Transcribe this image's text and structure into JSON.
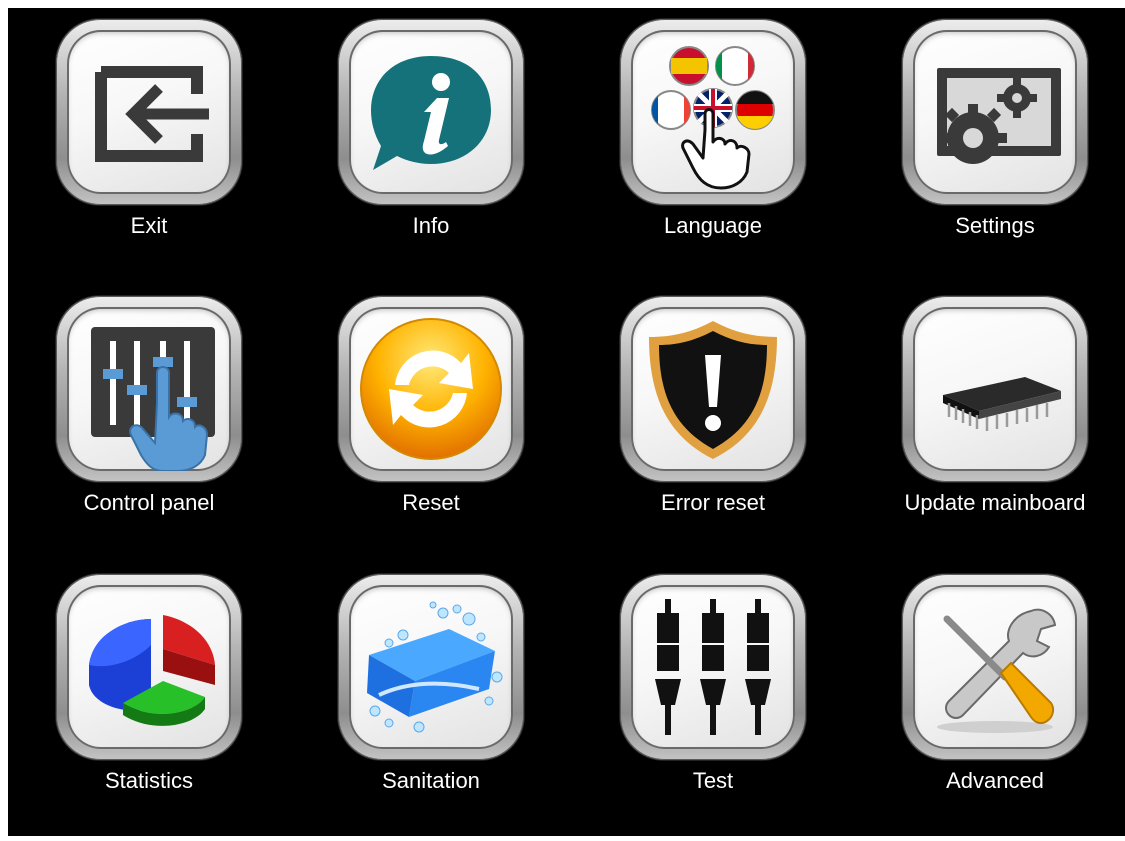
{
  "menu": {
    "items": [
      {
        "label": "Exit",
        "icon": "exit-icon"
      },
      {
        "label": "Info",
        "icon": "info-icon"
      },
      {
        "label": "Language",
        "icon": "language-icon"
      },
      {
        "label": "Settings",
        "icon": "settings-icon"
      },
      {
        "label": "Control panel",
        "icon": "control-panel-icon"
      },
      {
        "label": "Reset",
        "icon": "reset-icon"
      },
      {
        "label": "Error reset",
        "icon": "error-reset-icon"
      },
      {
        "label": "Update mainboard",
        "icon": "chip-icon"
      },
      {
        "label": "Statistics",
        "icon": "pie-chart-icon"
      },
      {
        "label": "Sanitation",
        "icon": "sanitation-icon"
      },
      {
        "label": "Test",
        "icon": "test-plugs-icon"
      },
      {
        "label": "Advanced",
        "icon": "tools-icon"
      }
    ]
  },
  "colors": {
    "background": "#000000",
    "label": "#ffffff",
    "info_teal": "#16727a",
    "reset_orange": "#f08a00",
    "shield_gold": "#e0a040"
  }
}
